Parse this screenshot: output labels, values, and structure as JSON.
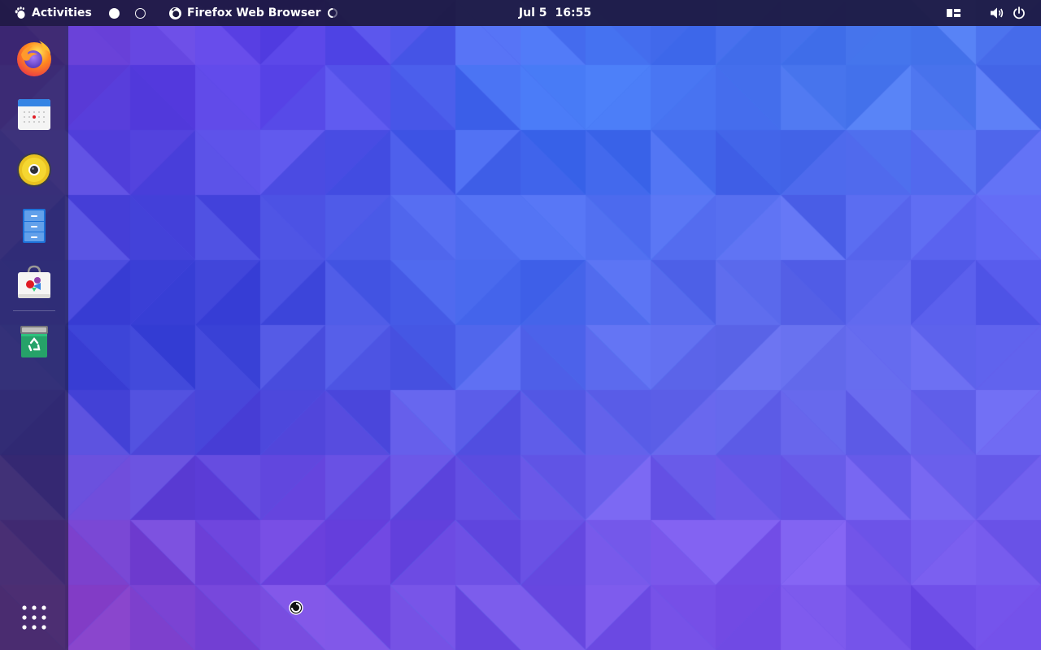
{
  "topbar": {
    "activities_label": "Activities",
    "app_name": "Firefox Web Browser",
    "date": "Jul 5",
    "time": "16:55",
    "workspace_indicator_icons": [
      "workspace-active-dot",
      "workspace-inactive-ring"
    ],
    "status_icons": [
      "keyboard-layout-icon",
      "volume-icon",
      "power-icon"
    ]
  },
  "dash": {
    "apps": [
      {
        "name": "Firefox",
        "icon": "firefox-icon"
      },
      {
        "name": "Calendar",
        "icon": "calendar-icon"
      },
      {
        "name": "Rhythmbox",
        "icon": "speaker-icon"
      },
      {
        "name": "Files",
        "icon": "files-icon"
      },
      {
        "name": "Software",
        "icon": "software-bag-icon"
      },
      {
        "name": "Trash",
        "icon": "trash-icon"
      }
    ],
    "show_apps_icon": "app-grid-icon"
  },
  "colors": {
    "topbar_bg": "#1c183e",
    "dash_bg": "#221e3a",
    "wallpaper_base": "#5a4ad6"
  }
}
